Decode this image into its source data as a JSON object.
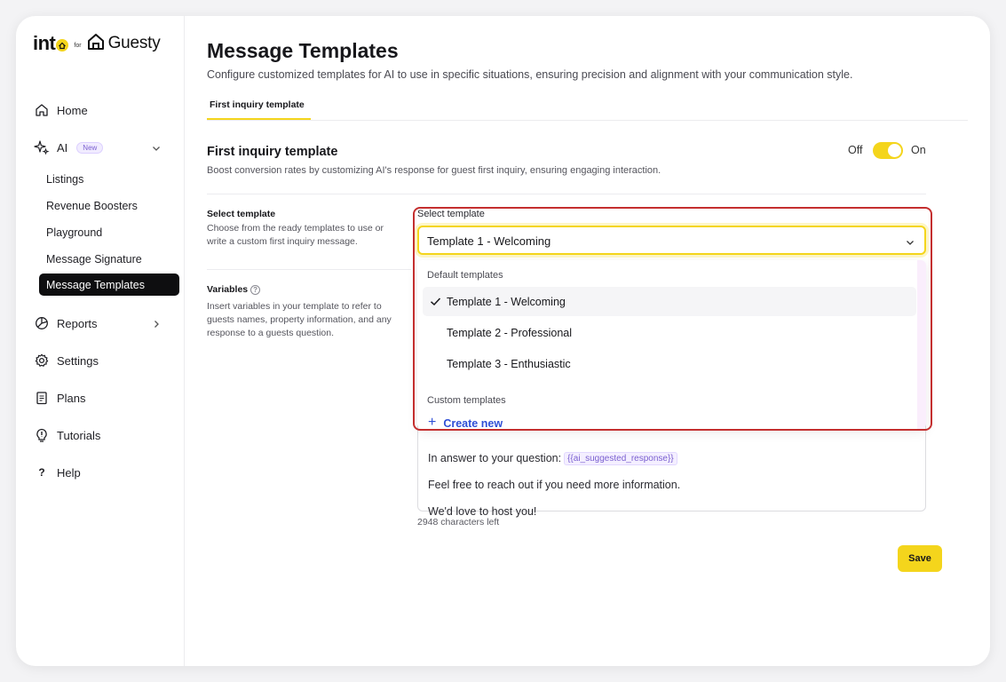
{
  "brand": {
    "into": "int",
    "for": "for",
    "guesty": "Guesty"
  },
  "sidebar": {
    "home": "Home",
    "ai": "AI",
    "ai_badge": "New",
    "ai_items": [
      "Listings",
      "Revenue Boosters",
      "Playground",
      "Message Signature",
      "Message Templates"
    ],
    "reports": "Reports",
    "settings": "Settings",
    "plans": "Plans",
    "tutorials": "Tutorials",
    "help": "Help"
  },
  "header": {
    "title": "Message Templates",
    "subtitle": "Configure customized templates for AI to use in specific situations, ensuring precision and alignment with your communication style."
  },
  "tabs": [
    {
      "label": "First inquiry template",
      "active": true
    }
  ],
  "section": {
    "title": "First inquiry template",
    "description": "Boost conversion rates by customizing AI's response for guest first inquiry, ensuring engaging interaction.",
    "toggle_off": "Off",
    "toggle_on": "On",
    "toggle_enabled": true
  },
  "select_template": {
    "title": "Select template",
    "description": "Choose from the ready templates to use or write a custom first inquiry message.",
    "label": "Select template",
    "value": "Template 1 - Welcoming",
    "menu": {
      "default_group": "Default templates",
      "default_options": [
        "Template 1 - Welcoming",
        "Template 2 - Professional",
        "Template 3 - Enthusiastic"
      ],
      "selected_index": 0,
      "custom_group": "Custom templates",
      "create_new": "Create new"
    }
  },
  "variables": {
    "title": "Variables",
    "description": "Insert variables in your template to refer to guests names, property information, and any response to a guests question."
  },
  "editor": {
    "line1_text": "In answer to your question:",
    "line1_var": "{{ai_suggested_response}}",
    "line2": "Feel free to reach out if you need more information.",
    "line3": "We'd love to host you!"
  },
  "chars_left": "2948 characters left",
  "save_label": "Save",
  "colors": {
    "accent": "#f4d51c",
    "active_nav": "#0e0e10",
    "link": "#2f4fd6",
    "highlight_outline": "#c42f2f",
    "variable_chip": "#7a5fd0"
  },
  "icons": {
    "home": "home-icon",
    "ai": "sparkles-icon",
    "reports": "pie-chart-icon",
    "settings": "gear-icon",
    "plans": "clipboard-icon",
    "tutorials": "lightbulb-icon",
    "help": "question-icon"
  }
}
